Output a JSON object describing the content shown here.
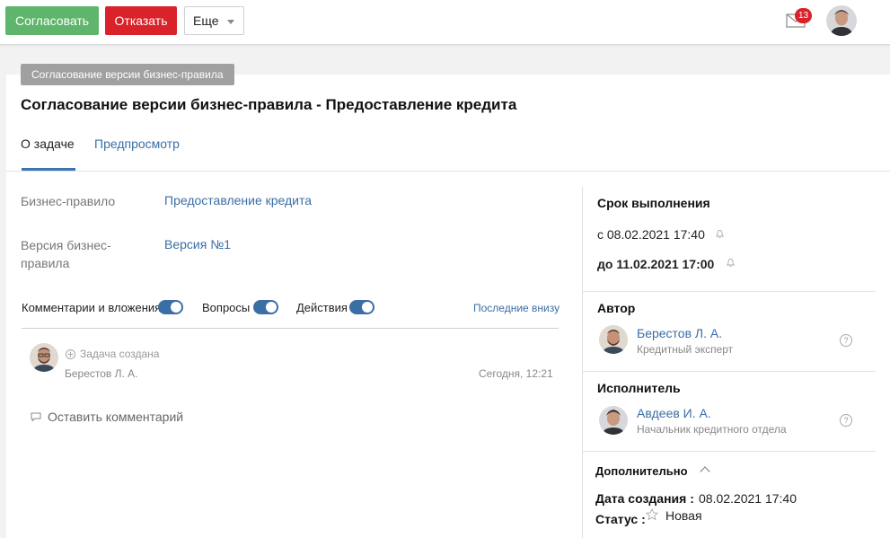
{
  "toolbar": {
    "approve_label": "Согласовать",
    "reject_label": "Отказать",
    "more_label": "Еще",
    "notifications_count": "13"
  },
  "task": {
    "tag": "Согласование версии бизнес-правила",
    "title": "Согласование версии бизнес-правила - Предоставление кредита"
  },
  "tabs": [
    {
      "label": "О задаче",
      "active": true
    },
    {
      "label": "Предпросмотр",
      "active": false
    }
  ],
  "details": {
    "rule_label": "Бизнес-правило",
    "rule_value": "Предоставление кредита",
    "version_label_line1": "Версия бизнес-",
    "version_label_line2": "правила",
    "version_value": "Версия №1"
  },
  "feed": {
    "filters": [
      {
        "label": "Комментарии и вложения",
        "on": true
      },
      {
        "label": "Вопросы",
        "on": true
      },
      {
        "label": "Действия",
        "on": true
      }
    ],
    "sort_label": "Последние внизу",
    "event_text": "Задача создана",
    "event_author": "Берестов Л. А.",
    "event_time": "Сегодня, 12:21",
    "comment_link": "Оставить комментарий"
  },
  "sidebar": {
    "deadline_heading": "Срок выполнения",
    "from_text": "с 08.02.2021 17:40",
    "to_text": "до 11.02.2021 17:00",
    "author_heading": "Автор",
    "author_name": "Берестов Л. А.",
    "author_role": "Кредитный эксперт",
    "assignee_heading": "Исполнитель",
    "assignee_name": "Авдеев И. А.",
    "assignee_role": "Начальник кредитного отдела",
    "extra_heading": "Дополнительно",
    "created_label": "Дата создания :",
    "created_value": "08.02.2021 17:40",
    "status_label": "Статус :",
    "status_value": "Новая",
    "help_glyph": "?"
  },
  "colors": {
    "approve": "#5fb56c",
    "reject": "#d9222a",
    "link": "#3b6ea5",
    "tag": "#a0a0a0"
  },
  "icons": [
    "mail-icon",
    "bell-icon",
    "help-icon",
    "star-icon",
    "comment-icon",
    "plus-circle-icon",
    "chevron-up-icon",
    "chevron-down-icon"
  ]
}
